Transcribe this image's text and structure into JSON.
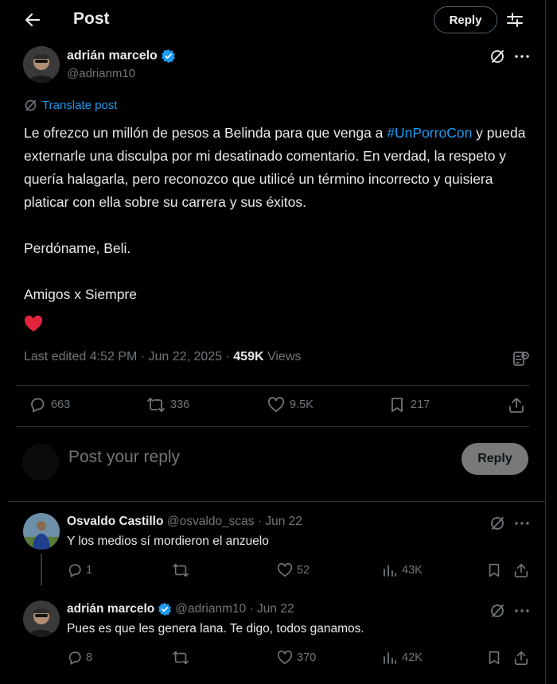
{
  "header": {
    "title": "Post",
    "reply_label": "Reply"
  },
  "post": {
    "author_name": "adrián marcelo",
    "author_handle": "@adrianm10",
    "translate_label": "Translate post",
    "text_before": "Le ofrezco un millón de pesos a Belinda para que venga a ",
    "hashtag": "#UnPorroCon",
    "text_after": " y pueda externarle una disculpa por mi desatinado comentario. En verdad, la respeto y quería halagarla, pero reconozco que utilicé un término incorrecto y quisiera platicar con ella sobre su carrera y sus éxitos.\n\nPerdóname, Beli.\n\nAmigos x Siempre",
    "edited_label": "Last edited 4:52 PM · Jun 22, 2025 · ",
    "views_count": "459K",
    "views_label": " Views",
    "stats": {
      "replies": "663",
      "reposts": "336",
      "likes": "9.5K",
      "bookmarks": "217"
    }
  },
  "composer": {
    "placeholder": "Post your reply",
    "button_label": "Reply"
  },
  "replies": [
    {
      "name": "Osvaldo Castillo",
      "meta": "@osvaldo_scas · Jun 22",
      "text": "Y los medios sí mordieron el anzuelo",
      "replies": "1",
      "likes": "52",
      "views": "43K"
    },
    {
      "name": "adrián marcelo",
      "meta": "@adrianm10 · Jun 22",
      "text": "Pues es que les genera lana. Te digo, todos ganamos.",
      "replies": "8",
      "likes": "370",
      "views": "42K"
    }
  ],
  "colors": {
    "accent": "#1d9bf0",
    "heart": "#f91880",
    "background": "#000000"
  }
}
